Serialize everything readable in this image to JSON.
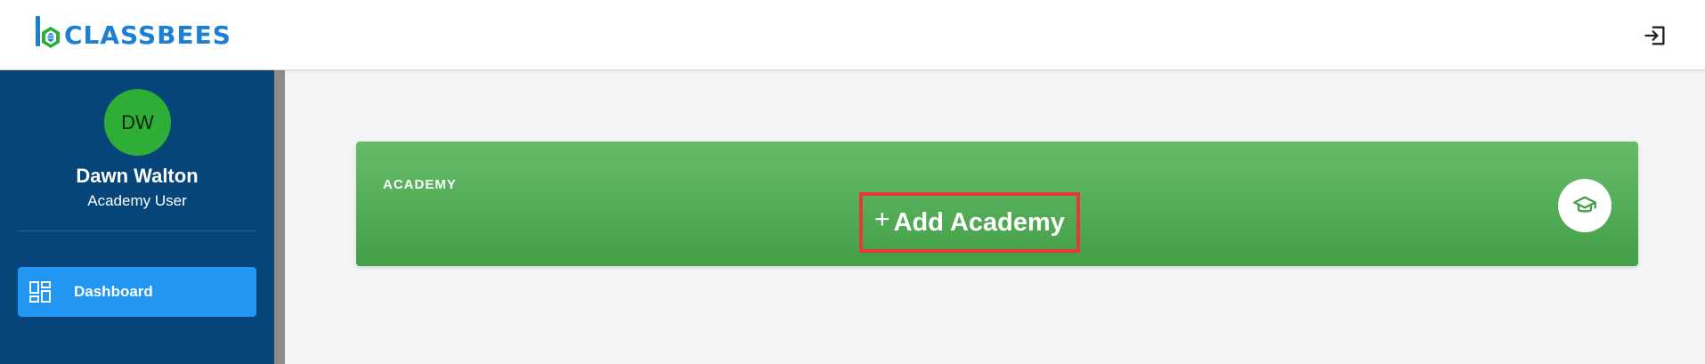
{
  "brand": {
    "name": "CLASSBEES",
    "primary_color": "#1c7fd4",
    "logo_icon": "bee-hexagon-logo-icon"
  },
  "header": {
    "logout_icon": "logout-icon"
  },
  "user": {
    "initials": "DW",
    "name": "Dawn Walton",
    "role": "Academy User",
    "avatar_color": "#2eae36"
  },
  "sidebar": {
    "bg_color": "#064579",
    "items": [
      {
        "label": "Dashboard",
        "icon": "dashboard-icon",
        "active": true,
        "active_color": "#2196f3"
      }
    ]
  },
  "academy_card": {
    "label": "ACADEMY",
    "add_plus": "+",
    "add_label": "Add Academy",
    "icon": "graduation-cap-icon",
    "color": "#4caf50",
    "highlight_color": "#e53935"
  }
}
